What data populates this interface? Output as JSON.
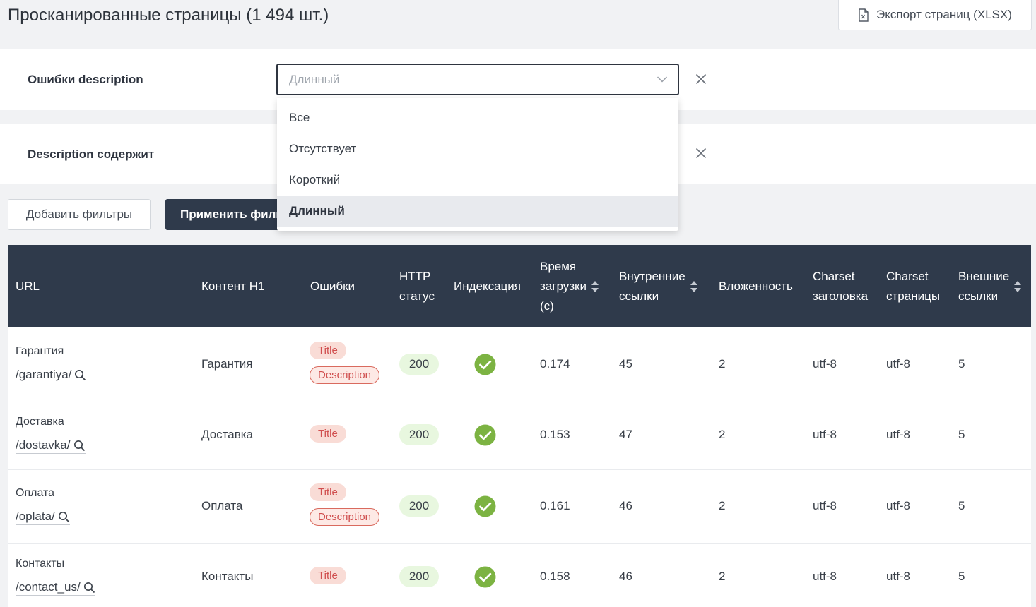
{
  "header": {
    "title": "Просканированные страницы (1 494 шт.)",
    "export_label": "Экспорт страниц (XLSX)"
  },
  "filters": {
    "description_errors": {
      "label": "Ошибки description",
      "selected": "Длинный",
      "options": [
        "Все",
        "Отсутствует",
        "Короткий",
        "Длинный"
      ]
    },
    "description_contains": {
      "label": "Description содержит"
    },
    "add_label": "Добавить фильтры",
    "apply_label": "Применить фильтры"
  },
  "table": {
    "columns": {
      "url": "URL",
      "h1": "Контент H1",
      "errors": "Ошибки",
      "http_1": "HTTP",
      "http_2": "статус",
      "index": "Индексация",
      "load_1": "Время",
      "load_2": "загрузки",
      "load_3": "(с)",
      "internal_1": "Внутренние",
      "internal_2": "ссылки",
      "depth": "Вложенность",
      "charset_h_1": "Charset",
      "charset_h_2": "заголовка",
      "charset_p_1": "Charset",
      "charset_p_2": "страницы",
      "external_1": "Внешние",
      "external_2": "ссылки"
    },
    "rows": [
      {
        "name": "Гарантия",
        "path": "/garantiya/",
        "h1": "Гарантия",
        "err1": "Title",
        "err2": "Description",
        "status": "200",
        "load": "0.174",
        "internal": "45",
        "depth": "2",
        "charset_header": "utf-8",
        "charset_page": "utf-8",
        "external": "5"
      },
      {
        "name": "Доставка",
        "path": "/dostavka/",
        "h1": "Доставка",
        "err1": "Title",
        "err2": "",
        "status": "200",
        "load": "0.153",
        "internal": "47",
        "depth": "2",
        "charset_header": "utf-8",
        "charset_page": "utf-8",
        "external": "5"
      },
      {
        "name": "Оплата",
        "path": "/oplata/",
        "h1": "Оплата",
        "err1": "Title",
        "err2": "Description",
        "status": "200",
        "load": "0.161",
        "internal": "46",
        "depth": "2",
        "charset_header": "utf-8",
        "charset_page": "utf-8",
        "external": "5"
      },
      {
        "name": "Контакты",
        "path": "/contact_us/",
        "h1": "Контакты",
        "err1": "Title",
        "err2": "",
        "status": "200",
        "load": "0.158",
        "internal": "46",
        "depth": "2",
        "charset_header": "utf-8",
        "charset_page": "utf-8",
        "external": "5"
      }
    ]
  },
  "colors": {
    "header_bg": "#2f3a4b",
    "check_green": "#7cb342",
    "error_red": "#d04f4f",
    "status_green_bg": "#e8f7df"
  }
}
